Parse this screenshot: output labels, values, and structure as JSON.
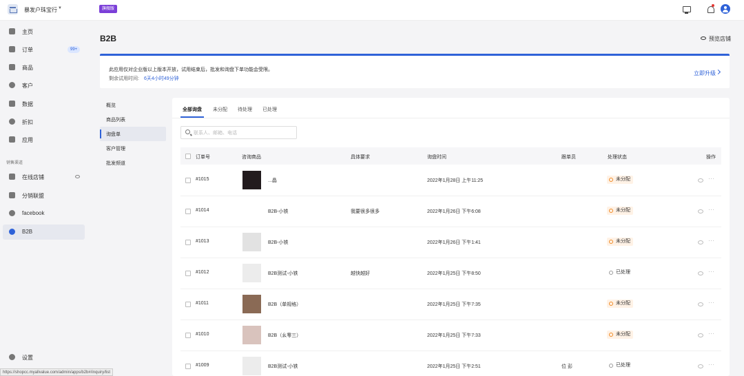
{
  "topbar": {
    "store_name": "暴发户珠宝行",
    "plan_badge": "旗舰版"
  },
  "sidebar": {
    "items": [
      {
        "label": "主页"
      },
      {
        "label": "订单",
        "badge": "99+"
      },
      {
        "label": "商品"
      },
      {
        "label": "客户"
      },
      {
        "label": "数据"
      },
      {
        "label": "折扣"
      },
      {
        "label": "应用"
      }
    ],
    "section_label": "销售渠道",
    "channels": [
      {
        "label": "在线店铺"
      },
      {
        "label": "分销联盟"
      },
      {
        "label": "facebook"
      },
      {
        "label": "B2B"
      }
    ],
    "settings_label": "设置"
  },
  "status_url": "https://shopcc.myallvalue.com/admin/apps/b2b#/inquiry/list",
  "header": {
    "title": "B2B",
    "preview_label": "预览店铺"
  },
  "notice": {
    "text": "此应用仅对企业版以上版本开放，试用结束后，批发和询盘下单功能会受限。",
    "trial_label": "剩余试用时间:",
    "trial_value": "6天4小时49分钟",
    "upgrade_label": "立即升级"
  },
  "subnav": [
    {
      "label": "概览"
    },
    {
      "label": "商品列表"
    },
    {
      "label": "询盘单"
    },
    {
      "label": "客户管理"
    },
    {
      "label": "批发频道"
    }
  ],
  "tabs": [
    {
      "label": "全部询盘"
    },
    {
      "label": "未分配"
    },
    {
      "label": "待处理"
    },
    {
      "label": "已处理"
    }
  ],
  "search": {
    "placeholder": "联系人、邮箱、电话"
  },
  "table": {
    "headers": [
      "订单号",
      "咨询商品",
      "具体要求",
      "询盘时间",
      "跟单员",
      "处理状态",
      "操作"
    ],
    "rows": [
      {
        "id": "#1015",
        "product": "...晶",
        "requirement": "",
        "time": "2022年1月28日 上午11:25",
        "staff": "",
        "status": "未分配",
        "status_kind": "orange",
        "thumb_color": "#221b1d"
      },
      {
        "id": "#1014",
        "product": "B2B-小铁",
        "requirement": "我要很多很多",
        "time": "2022年1月26日 下午6:08",
        "staff": "",
        "status": "未分配",
        "status_kind": "orange",
        "thumb_color": "#ffffff"
      },
      {
        "id": "#1013",
        "product": "B2B-小铁",
        "requirement": "",
        "time": "2022年1月26日 下午1:41",
        "staff": "",
        "status": "未分配",
        "status_kind": "orange",
        "thumb_color": "#e2e2e2"
      },
      {
        "id": "#1012",
        "product": "B2B测试-小铁",
        "requirement": "越快越好",
        "time": "2022年1月25日 下午8:50",
        "staff": "",
        "status": "已处理",
        "status_kind": "gray",
        "thumb_color": "#ececec"
      },
      {
        "id": "#1011",
        "product": "B2B（单规格）",
        "requirement": "",
        "time": "2022年1月25日 下午7:35",
        "staff": "",
        "status": "未分配",
        "status_kind": "orange",
        "thumb_color": "#8a6a55"
      },
      {
        "id": "#1010",
        "product": "B2B（幺零三）",
        "requirement": "",
        "time": "2022年1月25日 下午7:33",
        "staff": "",
        "status": "未分配",
        "status_kind": "orange",
        "thumb_color": "#d9c3bd"
      },
      {
        "id": "#1009",
        "product": "B2B测试-小铁",
        "requirement": "",
        "time": "2022年1月25日 下午2:51",
        "staff": "位 彭",
        "status": "已处理",
        "status_kind": "gray",
        "thumb_color": "#ececec"
      }
    ]
  },
  "colors": {
    "accent": "#2f62d8",
    "badge_purple": "#7b3fd8",
    "status_orange": "#f08a24"
  }
}
